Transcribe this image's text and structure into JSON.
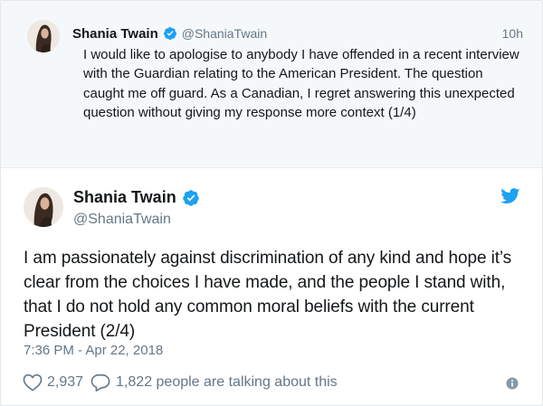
{
  "parent_tweet": {
    "display_name": "Shania Twain",
    "handle": "@ShaniaTwain",
    "time_label": "10h",
    "text": "I would like to apologise to anybody I have offended in a recent interview with the Guardian relating to the American President. The question caught me off guard. As a Canadian, I regret answering this unexpected question without giving my response more context (1/4)"
  },
  "main_tweet": {
    "display_name": "Shania Twain",
    "handle": "@ShaniaTwain",
    "text": "I am passionately against discrimination of any kind and hope it’s clear from the choices I have made, and the people I stand with, that I do not hold any common moral beliefs with the current President (2/4)",
    "timestamp": "7:36 PM - Apr 22, 2018",
    "like_count": "2,937",
    "reply_text": "1,822 people are talking about this"
  },
  "icons": {
    "verified": "verified-badge-icon",
    "twitter": "twitter-bird-icon",
    "like": "heart-icon",
    "reply": "reply-bubble-icon",
    "info": "info-icon"
  },
  "colors": {
    "brand_blue": "#1da1f2",
    "text": "#14171a",
    "muted": "#657786",
    "parent_bg": "#f5f8fa"
  }
}
